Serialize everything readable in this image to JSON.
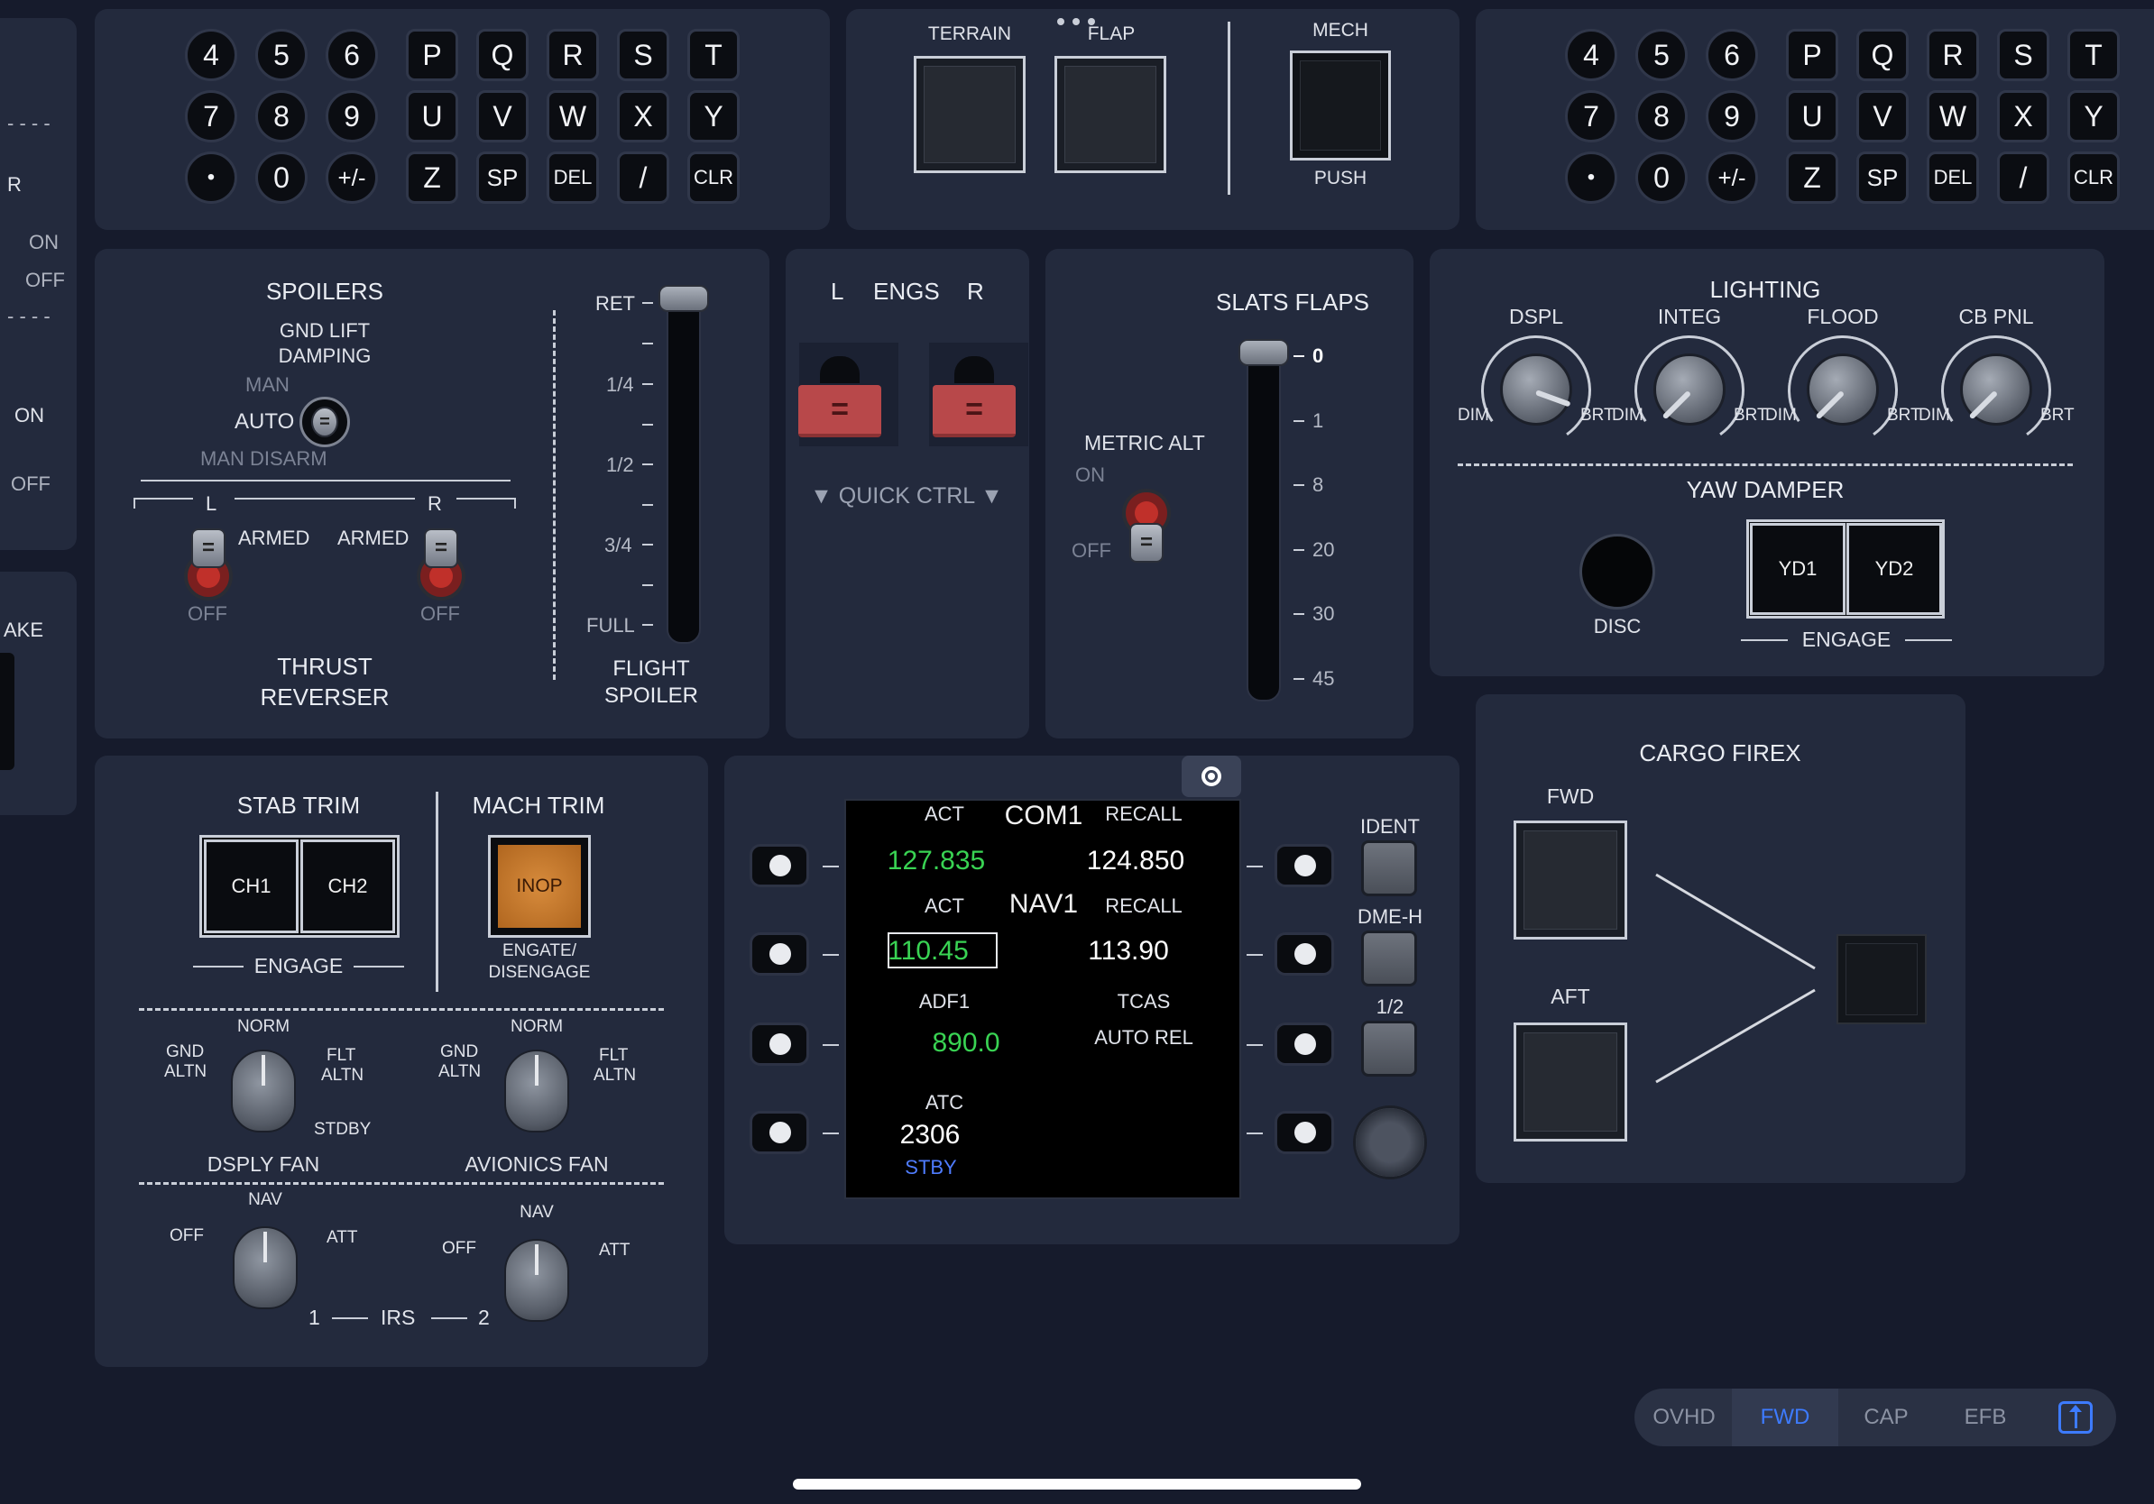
{
  "keypad_left": {
    "digits": [
      "4",
      "5",
      "6",
      "7",
      "8",
      "9",
      "•",
      "0",
      "+/-"
    ],
    "letters": [
      "P",
      "Q",
      "R",
      "S",
      "T",
      "U",
      "V",
      "W",
      "X",
      "Y",
      "Z",
      "SP",
      "DEL",
      "/",
      "CLR"
    ]
  },
  "keypad_right": {
    "digits": [
      "4",
      "5",
      "6",
      "7",
      "8",
      "9",
      "•",
      "0",
      "+/-"
    ],
    "letters": [
      "P",
      "Q",
      "R",
      "S",
      "T",
      "U",
      "V",
      "W",
      "X",
      "Y",
      "Z",
      "SP",
      "DEL",
      "/",
      "CLR"
    ]
  },
  "gpws": {
    "terrain": "TERRAIN",
    "flap": "FLAP",
    "mech": "MECH",
    "push": "PUSH"
  },
  "left_edge": {
    "r": "R",
    "on1": "ON",
    "off1": "OFF",
    "on2": "ON",
    "off2": "OFF",
    "ake": "AKE"
  },
  "spoilers": {
    "title": "SPOILERS",
    "gnd_lift_1": "GND LIFT",
    "gnd_lift_2": "DAMPING",
    "man": "MAN",
    "auto": "AUTO",
    "man_disarm": "MAN DISARM",
    "l": "L",
    "r": "R",
    "armed_l": "ARMED",
    "armed_r": "ARMED",
    "off_l": "OFF",
    "off_r": "OFF",
    "thrust_1": "THRUST",
    "thrust_2": "REVERSER",
    "scale": [
      "RET",
      "1/4",
      "1/2",
      "3/4",
      "FULL"
    ],
    "flight_1": "FLIGHT",
    "flight_2": "SPOILER"
  },
  "engs": {
    "l": "L",
    "title": "ENGS",
    "r": "R",
    "quick": "▼ QUICK CTRL ▼"
  },
  "slats": {
    "title": "SLATS FLAPS",
    "metric": "METRIC ALT",
    "on": "ON",
    "off": "OFF",
    "scale": [
      "0",
      "1",
      "8",
      "20",
      "30",
      "45"
    ]
  },
  "lighting": {
    "title": "LIGHTING",
    "knobs": [
      "DSPL",
      "INTEG",
      "FLOOD",
      "CB PNL"
    ],
    "dim": "DIM",
    "brt": "BRT",
    "yaw": "YAW DAMPER",
    "disc": "DISC",
    "yd1": "YD1",
    "yd2": "YD2",
    "engage": "ENGAGE"
  },
  "trim": {
    "stab": "STAB TRIM",
    "ch1": "CH1",
    "ch2": "CH2",
    "engage": "ENGAGE",
    "mach": "MACH TRIM",
    "inop": "INOP",
    "eng1": "ENGATE/",
    "eng2": "DISENGAGE"
  },
  "fans": {
    "norm": "NORM",
    "gnd1": "GND",
    "gnd2": "ALTN",
    "flt1": "FLT",
    "flt2": "ALTN",
    "stdby": "STDBY",
    "dsply": "DSPLY FAN",
    "avionics": "AVIONICS FAN"
  },
  "irs": {
    "nav": "NAV",
    "off": "OFF",
    "att": "ATT",
    "one": "1",
    "label": "IRS",
    "two": "2"
  },
  "radio": {
    "act1": "ACT",
    "com1": "COM1",
    "recall1": "RECALL",
    "com_active": "127.835",
    "com_standby": "124.850",
    "act2": "ACT",
    "nav1": "NAV1",
    "recall2": "RECALL",
    "nav_active": "110.45",
    "nav_standby": "113.90",
    "adf": "ADF1",
    "tcas": "TCAS",
    "adf_freq": "890.0",
    "auto_rel": "AUTO REL",
    "atc": "ATC",
    "squawk": "2306",
    "stby": "STBY",
    "ident": "IDENT",
    "dme": "DME-H",
    "half": "1/2"
  },
  "cargo": {
    "title": "CARGO FIREX",
    "fwd": "FWD",
    "aft": "AFT"
  },
  "tabs": [
    "OVHD",
    "FWD",
    "CAP",
    "EFB"
  ],
  "colors": {
    "active_green": "#39d353",
    "stby_blue": "#4f7cff",
    "inop_orange": "#c77a2c",
    "tab_active": "#3d7bff"
  }
}
